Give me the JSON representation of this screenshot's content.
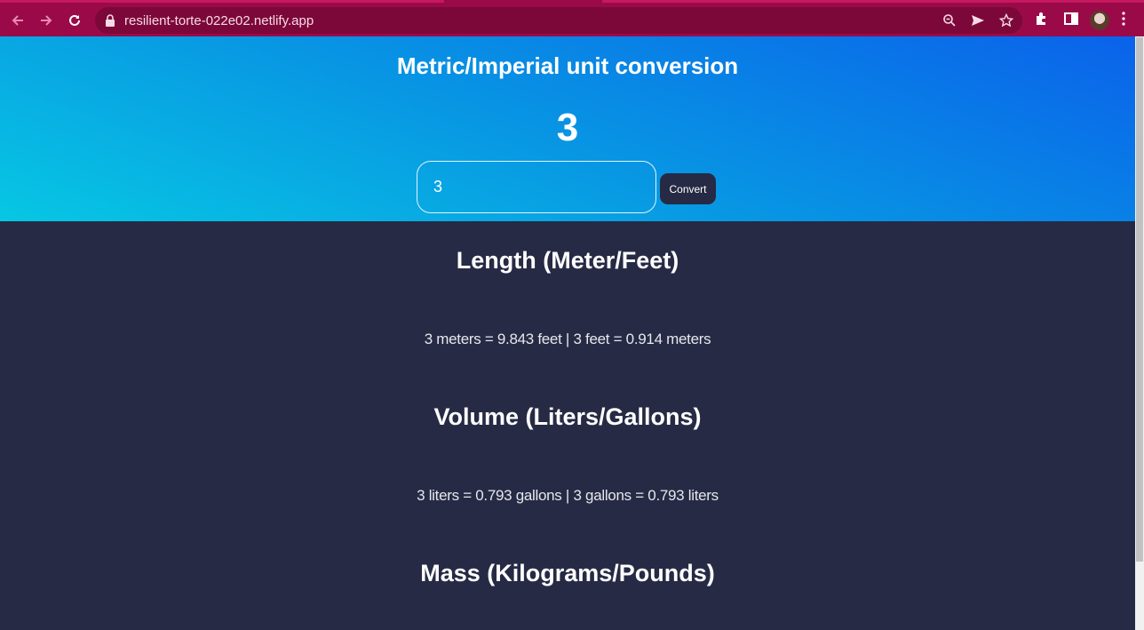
{
  "browser": {
    "url": "resilient-torte-022e02.netlify.app",
    "icons": [
      "back-arrow-icon",
      "forward-arrow-icon",
      "reload-icon",
      "lock-icon",
      "zoom-icon",
      "send-icon",
      "star-icon",
      "extensions-icon",
      "sidepanel-icon",
      "avatar",
      "menu-icon"
    ]
  },
  "header": {
    "title": "Metric/Imperial unit conversion",
    "display_value": "3",
    "input_value": "3",
    "convert_label": "Convert"
  },
  "sections": [
    {
      "title": "Length (Meter/Feet)",
      "result": "3 meters = 9.843 feet | 3 feet = 0.914 meters"
    },
    {
      "title": "Volume (Liters/Gallons)",
      "result": "3 liters = 0.793 gallons | 3 gallons = 0.793 liters"
    },
    {
      "title": "Mass (Kilograms/Pounds)",
      "result": ""
    }
  ],
  "colors": {
    "chrome": "#9a0a49",
    "hero_gradient_start": "#0a62ea",
    "hero_gradient_end": "#07c7e3",
    "body_background": "#262a44"
  }
}
